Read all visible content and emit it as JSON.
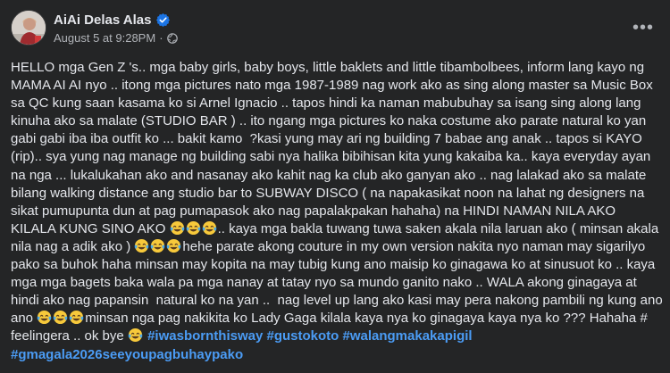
{
  "post": {
    "author": "AiAi Delas Alas",
    "date": "August 5 at 9:28PM",
    "separator": "·",
    "more_label": "•••",
    "icons": {
      "verified": "verified-badge-icon",
      "audience": "globe-icon",
      "emoji": "tears-of-joy-emoji"
    },
    "colors": {
      "background": "#242526",
      "text": "#e4e6eb",
      "secondary_text": "#b0b3b8",
      "hashtag": "#4b9cf5",
      "verified": "#1b74e4"
    },
    "body": {
      "p1": "HELLO mga Gen Z 's.. mga baby girls, baby boys, little baklets and little tibambolbees, inform lang kayo ng MAMA AI AI nyo .. itong mga pictures nato mga 1987-1989 nag work ako as sing along master sa Music Box sa QC kung saan kasama ko si Arnel Ignacio .. tapos hindi ka naman mabubuhay sa isang sing along lang kinuha ako sa malate (STUDIO BAR ) .. ito ngang mga pictures ko naka costume ako parate natural ko yan gabi gabi iba iba outfit ko ... bakit kamo  ?kasi yung may ari ng building 7 babae ang anak .. tapos si KAYO (rip).. sya yung nag manage ng building sabi nya halika bibihisan kita yung kakaiba ka.. kaya everyday ayan na nga ... lukalukahan ako and nasanay ako kahit nag ka club ako ganyan ako .. nag lalakad ako sa malate bilang walking distance ang studio bar to SUBWAY DISCO ( na napakasikat noon na lahat ng designers na sikat pumupunta dun at pag pumapasok ako nag papalakpakan hahaha) na HINDI NAMAN NILA AKO KILALA KUNG SINO AKO ",
      "p2": ".. kaya mga bakla tuwang tuwa saken akala nila laruan ako ( minsan akala nila nag a adik ako ) ",
      "p3": "hehe parate akong couture in my own version nakita nyo naman may sigarilyo pako sa buhok haha minsan may kopita na may tubig kung ano maisip ko ginagawa ko at sinusuot ko .. kaya mga mga bagets baka wala pa mga nanay at tatay nyo sa mundo ganito nako .. WALA akong ginagaya at hindi ako nag papansin  natural ko na yan ..  nag level up lang ako kasi may pera nakong pambili ng kung ano ano ",
      "p4": "minsan nga pag nakikita ko Lady Gaga kilala kaya nya ko ginagaya kaya nya ko ??? Hahaha # feelingera .. ok bye ",
      "hashtags": [
        "#iwasbornthisway",
        "#gustokoto",
        "#walangmakakapigil",
        "#gmagala2026seeyoupagbuhaypako"
      ]
    }
  }
}
